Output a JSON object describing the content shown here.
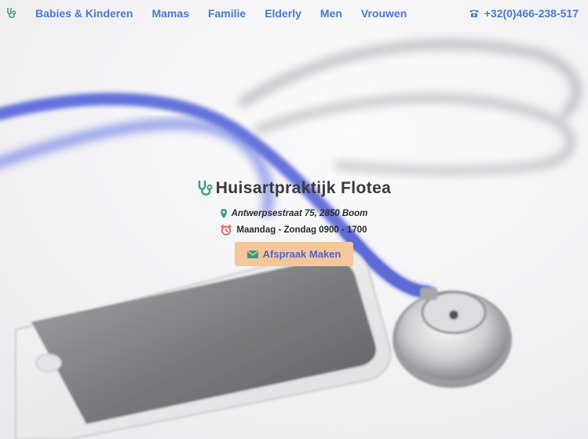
{
  "nav": {
    "logo_icon": "stethoscope-icon",
    "links": [
      "Babies & Kinderen",
      "Mamas",
      "Familie",
      "Elderly",
      "Men",
      "Vrouwen"
    ],
    "phone_icon": "phone-icon",
    "phone": "+32(0)466-238-517"
  },
  "hero": {
    "title_icon": "stethoscope-icon",
    "title": "Huisartpraktijk Flotea",
    "address_icon": "map-marker-icon",
    "address": "Antwerpsestraat 75, 2850 Boom",
    "hours_icon": "alarm-clock-icon",
    "hours": "Maandag - Zondag 0900 - 1700",
    "cta_icon": "envelope-icon",
    "cta_label": "Afspraak Maken"
  },
  "colors": {
    "nav_link": "#4a78c8",
    "title_icon": "#3a9a86",
    "cta_background": "#f3c79a",
    "cta_text": "#5563c8",
    "stethoscope_tube": "#4f5fd6"
  }
}
